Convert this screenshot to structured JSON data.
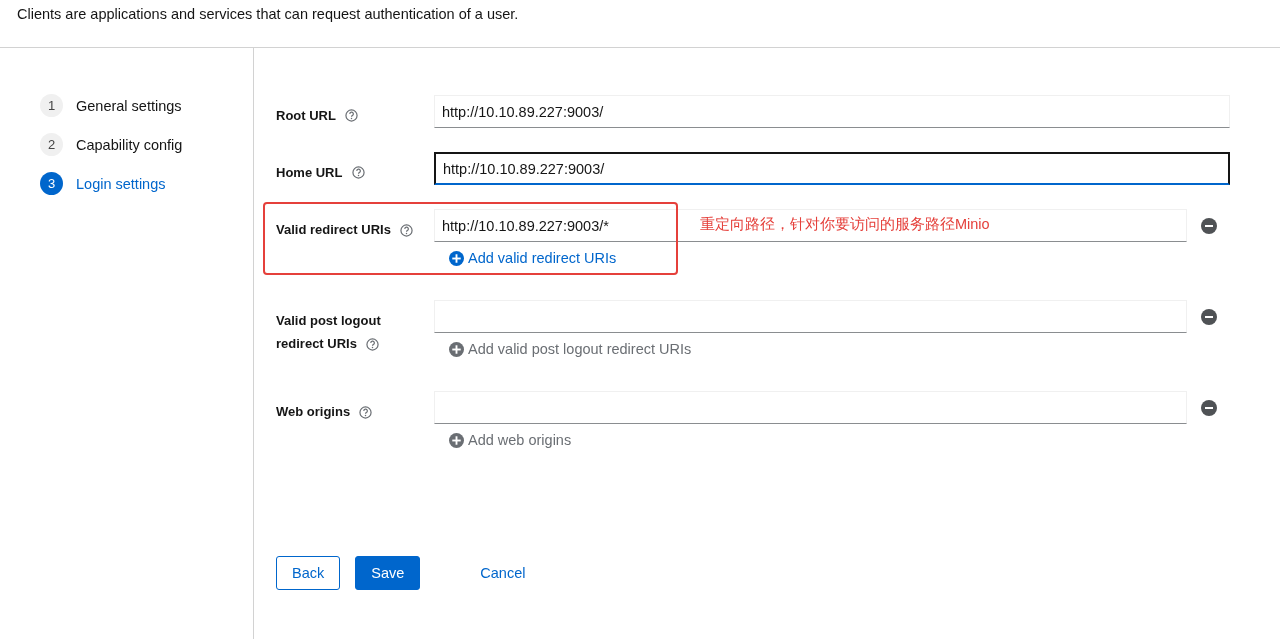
{
  "page": {
    "description": "Clients are applications and services that can request authentication of a user."
  },
  "steps": [
    {
      "number": "1",
      "label": "General settings",
      "selected": false
    },
    {
      "number": "2",
      "label": "Capability config",
      "selected": false
    },
    {
      "number": "3",
      "label": "Login settings",
      "selected": true
    }
  ],
  "fields": [
    {
      "kind": "single",
      "label": "Root URL",
      "value": "http://10.10.89.227:9003/",
      "focused": false
    },
    {
      "kind": "single",
      "label": "Home URL",
      "value": "http://10.10.89.227:9003/",
      "focused": true
    },
    {
      "kind": "multi",
      "label": "Valid redirect URIs",
      "value": "http://10.10.89.227:9003/*",
      "add_label": "Add valid redirect URIs",
      "add_enabled": true,
      "annotation": "重定向路径，针对你要访问的服务路径Minio"
    },
    {
      "kind": "multi",
      "label": "Valid post logout redirect URIs",
      "add_label": "Add valid post logout redirect URIs",
      "add_enabled": false
    },
    {
      "kind": "multi",
      "label": "Web origins",
      "add_label": "Add web origins",
      "add_enabled": false
    }
  ],
  "buttons": [
    {
      "kind": "secondary",
      "label": "Back"
    },
    {
      "kind": "primary",
      "label": "Save"
    },
    {
      "kind": "link",
      "label": "Cancel"
    }
  ]
}
